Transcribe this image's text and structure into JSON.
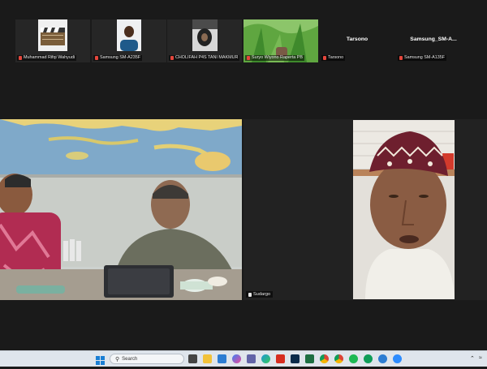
{
  "participants_strip": [
    {
      "name": "Muhammad Rifqi Wahyudi",
      "muted": true,
      "has_video": true
    },
    {
      "name": "Samsung SM-A235F",
      "muted": true,
      "has_video": true
    },
    {
      "name": "CHOLIFAH P4S TANI MAKMUR",
      "muted": true,
      "has_video": true
    },
    {
      "name": "Suryo Wiyono Raperta PB",
      "muted": true,
      "has_video": true,
      "speaking_border": true
    },
    {
      "name": "Tarsono",
      "muted": true,
      "has_video": false,
      "center_label": "Tarsono"
    },
    {
      "name": "Samsung SM-A135F",
      "muted": false,
      "has_video": false,
      "center_label": "Samsung_SM-A..."
    }
  ],
  "main_tiles": {
    "left": {
      "name": ""
    },
    "right": {
      "name": "Sudargo",
      "muted": false,
      "active_speaker": true
    }
  },
  "taskbar": {
    "search_placeholder": "Search",
    "apps": [
      "task-view-icon",
      "file-explorer-icon",
      "photos-icon",
      "copilot-icon",
      "teams-icon",
      "edge-icon",
      "acrobat-icon",
      "photoshop-icon",
      "excel-icon",
      "chrome-icon",
      "zoom-icon",
      "spotify-icon",
      "chrome-profile-icon",
      "settings-icon",
      "zoom-meetings-icon"
    ]
  },
  "colors": {
    "background": "#1a1a1a",
    "active_border": "#37c45f",
    "mic_muted": "#e5463c",
    "taskbar": "#dfe5ec"
  }
}
